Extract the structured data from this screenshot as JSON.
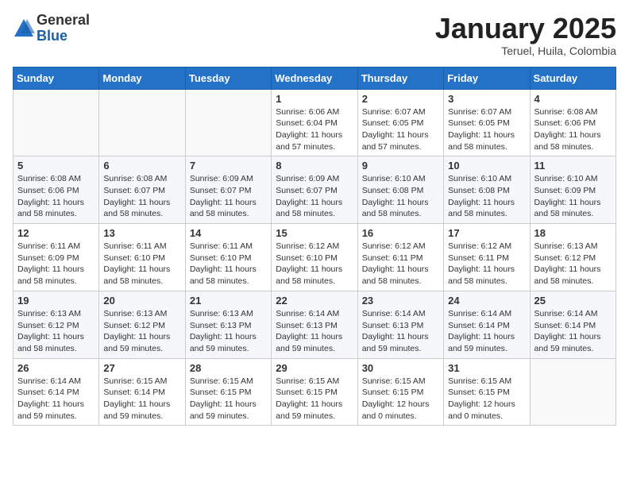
{
  "logo": {
    "general": "General",
    "blue": "Blue"
  },
  "header": {
    "month": "January 2025",
    "location": "Teruel, Huila, Colombia"
  },
  "days_of_week": [
    "Sunday",
    "Monday",
    "Tuesday",
    "Wednesday",
    "Thursday",
    "Friday",
    "Saturday"
  ],
  "weeks": [
    [
      {
        "day": "",
        "info": ""
      },
      {
        "day": "",
        "info": ""
      },
      {
        "day": "",
        "info": ""
      },
      {
        "day": "1",
        "info": "Sunrise: 6:06 AM\nSunset: 6:04 PM\nDaylight: 11 hours\nand 57 minutes."
      },
      {
        "day": "2",
        "info": "Sunrise: 6:07 AM\nSunset: 6:05 PM\nDaylight: 11 hours\nand 57 minutes."
      },
      {
        "day": "3",
        "info": "Sunrise: 6:07 AM\nSunset: 6:05 PM\nDaylight: 11 hours\nand 58 minutes."
      },
      {
        "day": "4",
        "info": "Sunrise: 6:08 AM\nSunset: 6:06 PM\nDaylight: 11 hours\nand 58 minutes."
      }
    ],
    [
      {
        "day": "5",
        "info": "Sunrise: 6:08 AM\nSunset: 6:06 PM\nDaylight: 11 hours\nand 58 minutes."
      },
      {
        "day": "6",
        "info": "Sunrise: 6:08 AM\nSunset: 6:07 PM\nDaylight: 11 hours\nand 58 minutes."
      },
      {
        "day": "7",
        "info": "Sunrise: 6:09 AM\nSunset: 6:07 PM\nDaylight: 11 hours\nand 58 minutes."
      },
      {
        "day": "8",
        "info": "Sunrise: 6:09 AM\nSunset: 6:07 PM\nDaylight: 11 hours\nand 58 minutes."
      },
      {
        "day": "9",
        "info": "Sunrise: 6:10 AM\nSunset: 6:08 PM\nDaylight: 11 hours\nand 58 minutes."
      },
      {
        "day": "10",
        "info": "Sunrise: 6:10 AM\nSunset: 6:08 PM\nDaylight: 11 hours\nand 58 minutes."
      },
      {
        "day": "11",
        "info": "Sunrise: 6:10 AM\nSunset: 6:09 PM\nDaylight: 11 hours\nand 58 minutes."
      }
    ],
    [
      {
        "day": "12",
        "info": "Sunrise: 6:11 AM\nSunset: 6:09 PM\nDaylight: 11 hours\nand 58 minutes."
      },
      {
        "day": "13",
        "info": "Sunrise: 6:11 AM\nSunset: 6:10 PM\nDaylight: 11 hours\nand 58 minutes."
      },
      {
        "day": "14",
        "info": "Sunrise: 6:11 AM\nSunset: 6:10 PM\nDaylight: 11 hours\nand 58 minutes."
      },
      {
        "day": "15",
        "info": "Sunrise: 6:12 AM\nSunset: 6:10 PM\nDaylight: 11 hours\nand 58 minutes."
      },
      {
        "day": "16",
        "info": "Sunrise: 6:12 AM\nSunset: 6:11 PM\nDaylight: 11 hours\nand 58 minutes."
      },
      {
        "day": "17",
        "info": "Sunrise: 6:12 AM\nSunset: 6:11 PM\nDaylight: 11 hours\nand 58 minutes."
      },
      {
        "day": "18",
        "info": "Sunrise: 6:13 AM\nSunset: 6:12 PM\nDaylight: 11 hours\nand 58 minutes."
      }
    ],
    [
      {
        "day": "19",
        "info": "Sunrise: 6:13 AM\nSunset: 6:12 PM\nDaylight: 11 hours\nand 58 minutes."
      },
      {
        "day": "20",
        "info": "Sunrise: 6:13 AM\nSunset: 6:12 PM\nDaylight: 11 hours\nand 59 minutes."
      },
      {
        "day": "21",
        "info": "Sunrise: 6:13 AM\nSunset: 6:13 PM\nDaylight: 11 hours\nand 59 minutes."
      },
      {
        "day": "22",
        "info": "Sunrise: 6:14 AM\nSunset: 6:13 PM\nDaylight: 11 hours\nand 59 minutes."
      },
      {
        "day": "23",
        "info": "Sunrise: 6:14 AM\nSunset: 6:13 PM\nDaylight: 11 hours\nand 59 minutes."
      },
      {
        "day": "24",
        "info": "Sunrise: 6:14 AM\nSunset: 6:14 PM\nDaylight: 11 hours\nand 59 minutes."
      },
      {
        "day": "25",
        "info": "Sunrise: 6:14 AM\nSunset: 6:14 PM\nDaylight: 11 hours\nand 59 minutes."
      }
    ],
    [
      {
        "day": "26",
        "info": "Sunrise: 6:14 AM\nSunset: 6:14 PM\nDaylight: 11 hours\nand 59 minutes."
      },
      {
        "day": "27",
        "info": "Sunrise: 6:15 AM\nSunset: 6:14 PM\nDaylight: 11 hours\nand 59 minutes."
      },
      {
        "day": "28",
        "info": "Sunrise: 6:15 AM\nSunset: 6:15 PM\nDaylight: 11 hours\nand 59 minutes."
      },
      {
        "day": "29",
        "info": "Sunrise: 6:15 AM\nSunset: 6:15 PM\nDaylight: 11 hours\nand 59 minutes."
      },
      {
        "day": "30",
        "info": "Sunrise: 6:15 AM\nSunset: 6:15 PM\nDaylight: 12 hours\nand 0 minutes."
      },
      {
        "day": "31",
        "info": "Sunrise: 6:15 AM\nSunset: 6:15 PM\nDaylight: 12 hours\nand 0 minutes."
      },
      {
        "day": "",
        "info": ""
      }
    ]
  ]
}
